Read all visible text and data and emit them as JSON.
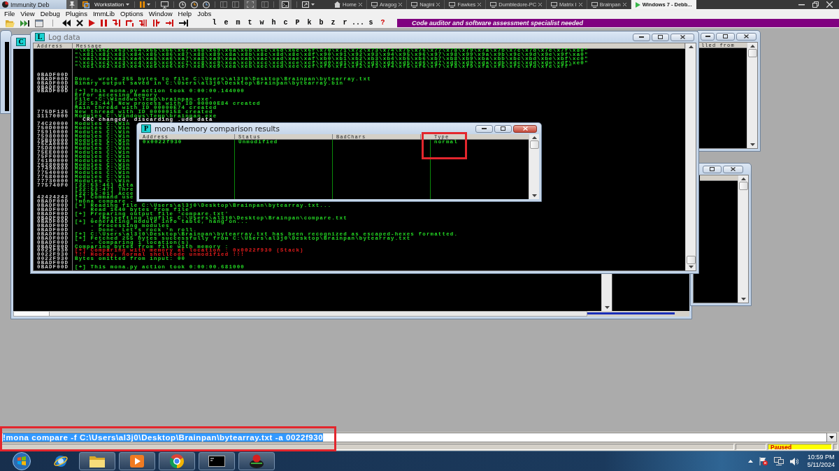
{
  "title_bar": {
    "title": "Immunity Deb"
  },
  "vm_toolbar": {
    "library_menu": "Workstation",
    "tabs": [
      {
        "label": "Home",
        "kind": "home",
        "selected": false
      },
      {
        "label": "Aragog",
        "kind": "vm",
        "selected": false
      },
      {
        "label": "Nagini",
        "kind": "vm",
        "selected": false
      },
      {
        "label": "Fawkes",
        "kind": "vm",
        "selected": false
      },
      {
        "label": "Dumbledore-PC",
        "kind": "vm",
        "selected": false
      },
      {
        "label": "Matrix I",
        "kind": "vm",
        "selected": false
      },
      {
        "label": "Brainpan",
        "kind": "vm",
        "selected": false
      },
      {
        "label": "Windows 7 - Debb...",
        "kind": "vm_running",
        "selected": true
      }
    ]
  },
  "menu_bar": {
    "items": [
      "File",
      "View",
      "Debug",
      "Plugins",
      "ImmLib",
      "Options",
      "Window",
      "Help",
      "Jobs"
    ]
  },
  "toolbar": {
    "letter_buttons": [
      "l",
      "e",
      "m",
      "t",
      "w",
      "h",
      "c",
      "P",
      "k",
      "b",
      "z",
      "r",
      "...",
      "s"
    ],
    "help_button": "?",
    "banner": "Code auditor and software assessment specialist needed"
  },
  "background_window": {
    "icon_letter": "C"
  },
  "side_window": {
    "column_header": "lled from"
  },
  "log_window": {
    "icon_letter": "L",
    "title": "Log data",
    "active": false,
    "columns": [
      "Address",
      "Message"
    ],
    "rows": [
      {
        "message": "\"\\x61\\x62\\x63\\x64\\x65\\x66\\x67\\x68\\x69\\x6a\\x6b\\x6c\\x6d\\x6e\\x6f\\x70\\x71\\x72\\x73\\x74\\x75\\x76\\x77\\x78\\x79\\x7a\\x7b\\x7c\\x7d\\x7e\\x7f\\x80\"",
        "kind": "info"
      },
      {
        "message": "\"\\x81\\x82\\x83\\x84\\x85\\x86\\x87\\x88\\x89\\x8a\\x8b\\x8c\\x8d\\x8e\\x8f\\x90\\x91\\x92\\x93\\x94\\x95\\x96\\x97\\x98\\x99\\x9a\\x9b\\x9c\\x9d\\x9e\\x9f\\xa0\"",
        "kind": "info"
      },
      {
        "message": "\"\\xa1\\xa2\\xa3\\xa4\\xa5\\xa6\\xa7\\xa8\\xa9\\xaa\\xab\\xac\\xad\\xae\\xaf\\xb0\\xb1\\xb2\\xb3\\xb4\\xb5\\xb6\\xb7\\xb8\\xb9\\xba\\xbb\\xbc\\xbd\\xbe\\xbf\\xc0\"",
        "kind": "info"
      },
      {
        "message": "\"\\xc1\\xc2\\xc3\\xc4\\xc5\\xc6\\xc7\\xc8\\xc9\\xca\\xcb\\xcc\\xcd\\xce\\xcf\\xd0\\xd1\\xd2\\xd3\\xd4\\xd5\\xd6\\xd7\\xd8\\xd9\\xda\\xdb\\xdc\\xdd\\xde\\xdf\\xe0\"",
        "kind": "info"
      },
      {
        "message": "\"\\xe1\\xe2\\xe3\\xe4\\xe5\\xe6\\xe7\\xe8\\xe9\\xea\\xeb\\xec\\xed\\xee\\xef\\xf0\\xf1\\xf2\\xf3\\xf4\\xf5\\xf6\\xf7\\xf8\\xf9\\xfa\\xfb\\xfc\\xfd\\xfe\\xff\"",
        "kind": "info"
      },
      {},
      {
        "address": "0BADF00D"
      },
      {
        "address": "0BADF00D",
        "message": "Done, wrote 255 bytes to file C:\\Users\\al3j0\\Desktop\\Brainpan\\bytearray.txt",
        "kind": "info"
      },
      {
        "address": "0BADF00D",
        "message": "Binary output saved in C:\\Users\\al3j0\\Desktop\\Brainpan\\bytearray.bin",
        "kind": "info"
      },
      {
        "address": "0BADF00D"
      },
      {
        "address": "0BADF00D",
        "message": "[+] This mona.py action took 0:00:00.144000",
        "kind": "info"
      },
      {
        "message": "Error accesing memory",
        "kind": "info"
      },
      {
        "message": "File 'C:\\Windows\\Temp\\brainpan.exe'",
        "kind": "info"
      },
      {
        "message": "[22:53:44] New process with ID 00000E84 created",
        "kind": "info"
      },
      {
        "message": "Main thread with ID 00000E74 created",
        "kind": "info"
      },
      {
        "address": "775DF125",
        "message": "New thread with ID 00000158 created",
        "kind": "info"
      },
      {
        "address": "31170000",
        "message": "Modules C:\\Windows\\Temp\\brainpan.exe",
        "kind": "info"
      },
      {
        "message": "  CRC changed, discarding .udd data",
        "kind": "plain"
      },
      {
        "address": "74C20000",
        "message": "Modules C:\\Win",
        "kind": "info"
      },
      {
        "address": "750D0000",
        "message": "Modules C:\\Win",
        "kind": "info"
      },
      {
        "address": "75910000",
        "message": "Modules C:\\Win",
        "kind": "info"
      },
      {
        "address": "75980000",
        "message": "Modules C:\\Win",
        "kind": "info"
      },
      {
        "address": "75B80000",
        "message": "Modules C:\\Win",
        "kind": "info"
      },
      {
        "address": "75CA0000",
        "message": "Modules C:\\Win",
        "kind": "info"
      },
      {
        "address": "75D80000",
        "message": "Modules C:\\Win",
        "kind": "info"
      },
      {
        "address": "75EE0000",
        "message": "Modules C:\\Win",
        "kind": "info"
      },
      {
        "address": "75FF0000",
        "message": "Modules C:\\Win",
        "kind": "info"
      },
      {
        "address": "761B0000",
        "message": "Modules C:\\Win",
        "kind": "info"
      },
      {
        "address": "76280000",
        "message": "Modules C:\\Win",
        "kind": "info"
      },
      {
        "address": "77490000",
        "message": "Modules C:\\Win",
        "kind": "info"
      },
      {
        "address": "77540000",
        "message": "Modules C:\\Win",
        "kind": "info"
      },
      {
        "address": "77680000",
        "message": "Modules C:\\Win",
        "kind": "info"
      },
      {
        "address": "77730000",
        "message": "Modules C:\\Win",
        "kind": "info"
      },
      {
        "address": "775740F0",
        "message": "[22:53:46] Atta",
        "kind": "info"
      },
      {
        "message": "[22:53:47] Thre",
        "kind": "info"
      },
      {
        "message": "[22:55:01] Acce",
        "kind": "info"
      },
      {
        "address": "42424242",
        "message": "[+] Command use",
        "kind": "info"
      },
      {
        "address": "0BADF00D",
        "message": "!mona compare -",
        "kind": "info"
      },
      {
        "address": "0BADF00D",
        "message": "[+] Reading file C:\\Users\\al3j0\\Desktop\\Brainpan\\bytearray.txt...",
        "kind": "info"
      },
      {
        "address": "0BADF00D",
        "message": "    Read 1640 bytes from file",
        "kind": "info"
      },
      {
        "address": "0BADF00D",
        "message": "[+] Preparing output file 'compare.txt'",
        "kind": "info"
      },
      {
        "address": "0BADF00D",
        "message": "    - (Re)setting logfile C:\\Users\\al3j0\\Desktop\\Brainpan\\compare.txt",
        "kind": "info"
      },
      {
        "address": "0BADF00D",
        "message": "[+] Generating module info table, hang on...",
        "kind": "info"
      },
      {
        "address": "0BADF00D",
        "message": "    - Processing modules",
        "kind": "info"
      },
      {
        "address": "0BADF00D",
        "message": "    - Done. Let's rock 'n roll.",
        "kind": "info"
      },
      {
        "address": "0BADF00D",
        "message": "[+] C:\\Users\\al3j0\\Desktop\\Brainpan\\bytearray.txt has been recognized as escaped-hexes formatted.",
        "kind": "info"
      },
      {
        "address": "0BADF00D",
        "message": "[+] Fetched 255 bytes successfully from C:\\Users\\al3j0\\Desktop\\Brainpan\\bytearray.txt",
        "kind": "info"
      },
      {
        "address": "0BADF00D",
        "message": "    - Comparing 1 location(s)",
        "kind": "info"
      },
      {
        "address": "0BADF00D",
        "message": "Comparing bytes from file with memory :",
        "kind": "info"
      },
      {
        "address": "0022F930",
        "message": "[+] Comparing with memory at location : 0x0022f930 (Stack)",
        "kind": "error"
      },
      {
        "address": "0022F930",
        "message": "!!! Hooray, normal shellcode unmodified !!!",
        "kind": "error"
      },
      {
        "address": "0022F930",
        "message": "Bytes omitted from input: 00",
        "kind": "info"
      },
      {
        "address": "0BADF00D"
      },
      {
        "address": "0BADF00D",
        "message": "[+] This mona.py action took 0:00:00.681000",
        "kind": "info"
      }
    ]
  },
  "comparison_window": {
    "icon_letter": "P",
    "title": "mona Memory comparison results",
    "active": true,
    "columns": [
      "Address",
      "Status",
      "BadChars",
      "Type"
    ],
    "rows": [
      {
        "address": "0x0022f930",
        "status": "Unmodified",
        "type": "normal"
      }
    ]
  },
  "command_bar": {
    "value": "!mona compare -f C:\\Users\\al3j0\\Desktop\\Brainpan\\bytearray.txt -a 0022f930",
    "text_selected": true
  },
  "status_bar": {
    "state": "Paused"
  },
  "taskbar": {
    "time": "10:59 PM",
    "date": "5/11/2024"
  }
}
